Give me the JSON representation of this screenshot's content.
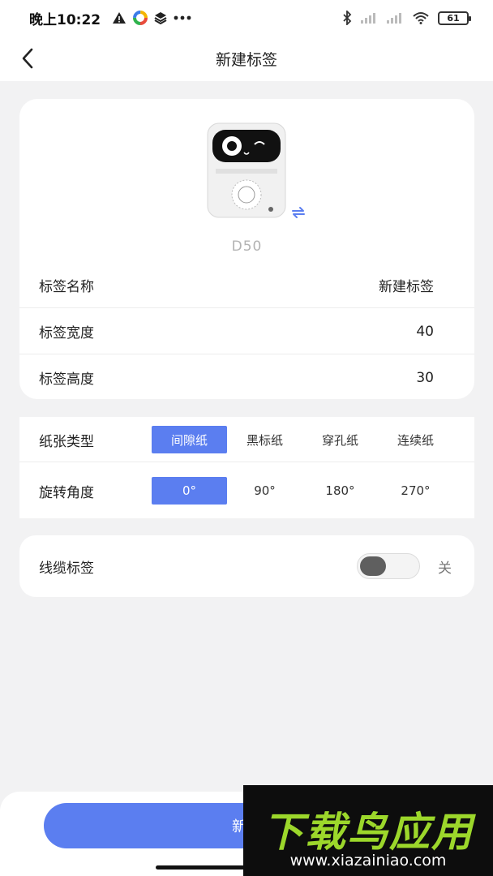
{
  "status_bar": {
    "time": "晚上10:22",
    "battery": "61",
    "icons_left": [
      "warning-icon",
      "color-wheel-icon",
      "layers-icon",
      "more-dots-icon"
    ],
    "icons_right": [
      "bluetooth-icon",
      "signal-icon",
      "signal-icon",
      "wifi-icon",
      "battery-icon"
    ]
  },
  "nav": {
    "title": "新建标签",
    "back_icon": "chevron-left-icon"
  },
  "device": {
    "name": "D50",
    "image": "printer-image",
    "switch_icon": "sync-icon"
  },
  "label_info": [
    {
      "label": "标签名称",
      "value": "新建标签"
    },
    {
      "label": "标签宽度",
      "value": "40"
    },
    {
      "label": "标签高度",
      "value": "30"
    }
  ],
  "paper_type": {
    "label": "纸张类型",
    "options": [
      "间隙纸",
      "黑标纸",
      "穿孔纸",
      "连续纸"
    ],
    "selected": "间隙纸"
  },
  "rotation": {
    "label": "旋转角度",
    "options": [
      "0°",
      "90°",
      "180°",
      "270°"
    ],
    "selected": "0°"
  },
  "cable_label": {
    "label": "线缆标签",
    "state": "关",
    "enabled": false
  },
  "primary_button": {
    "label": "新建"
  },
  "watermark": {
    "title": "下载鸟应用",
    "url": "www.xiazainiao.com"
  },
  "colors": {
    "accent": "#5b7ef0",
    "background": "#f2f2f3",
    "card": "#ffffff",
    "muted_text": "#b3b3b3"
  }
}
